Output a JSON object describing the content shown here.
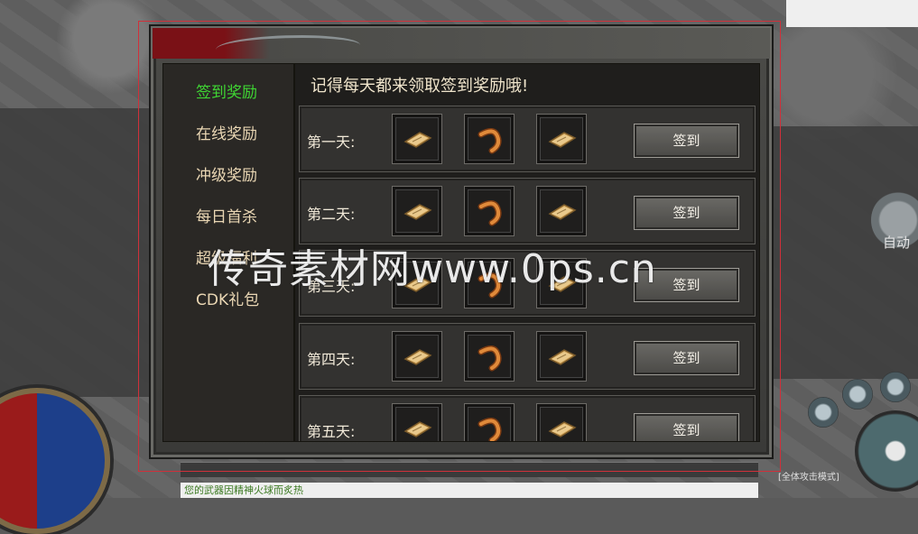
{
  "hud": {
    "chat_message": "您的武器因精神火球而炙热",
    "mode_text": "[全体攻击模式]",
    "auto_label": "自动"
  },
  "panel": {
    "tabs": [
      {
        "label": "签到奖励",
        "active": true
      },
      {
        "label": "在线奖励",
        "active": false
      },
      {
        "label": "冲级奖励",
        "active": false
      },
      {
        "label": "每日首杀",
        "active": false
      },
      {
        "label": "超级福利",
        "active": false
      },
      {
        "label": "CDK礼包",
        "active": false
      }
    ],
    "title": "记得每天都来领取签到奖励哦!",
    "days": [
      {
        "label": "第一天:",
        "button": "签到",
        "items": [
          "scroll-icon",
          "boomerang-icon",
          "scroll-icon"
        ]
      },
      {
        "label": "第二天:",
        "button": "签到",
        "items": [
          "scroll-icon",
          "boomerang-icon",
          "scroll-icon"
        ]
      },
      {
        "label": "第三天:",
        "button": "签到",
        "items": [
          "scroll-icon",
          "boomerang-icon",
          "scroll-icon"
        ]
      },
      {
        "label": "第四天:",
        "button": "签到",
        "items": [
          "scroll-icon",
          "boomerang-icon",
          "scroll-icon"
        ]
      },
      {
        "label": "第五天:",
        "button": "签到",
        "items": [
          "scroll-icon",
          "boomerang-icon",
          "scroll-icon"
        ]
      }
    ]
  },
  "watermark": "传奇素材网www.0ps.cn",
  "colors": {
    "active_tab": "#3fd633",
    "tab_text": "#ead7b4",
    "header_red": "#7a1116",
    "frame_red": "#d0303a"
  }
}
